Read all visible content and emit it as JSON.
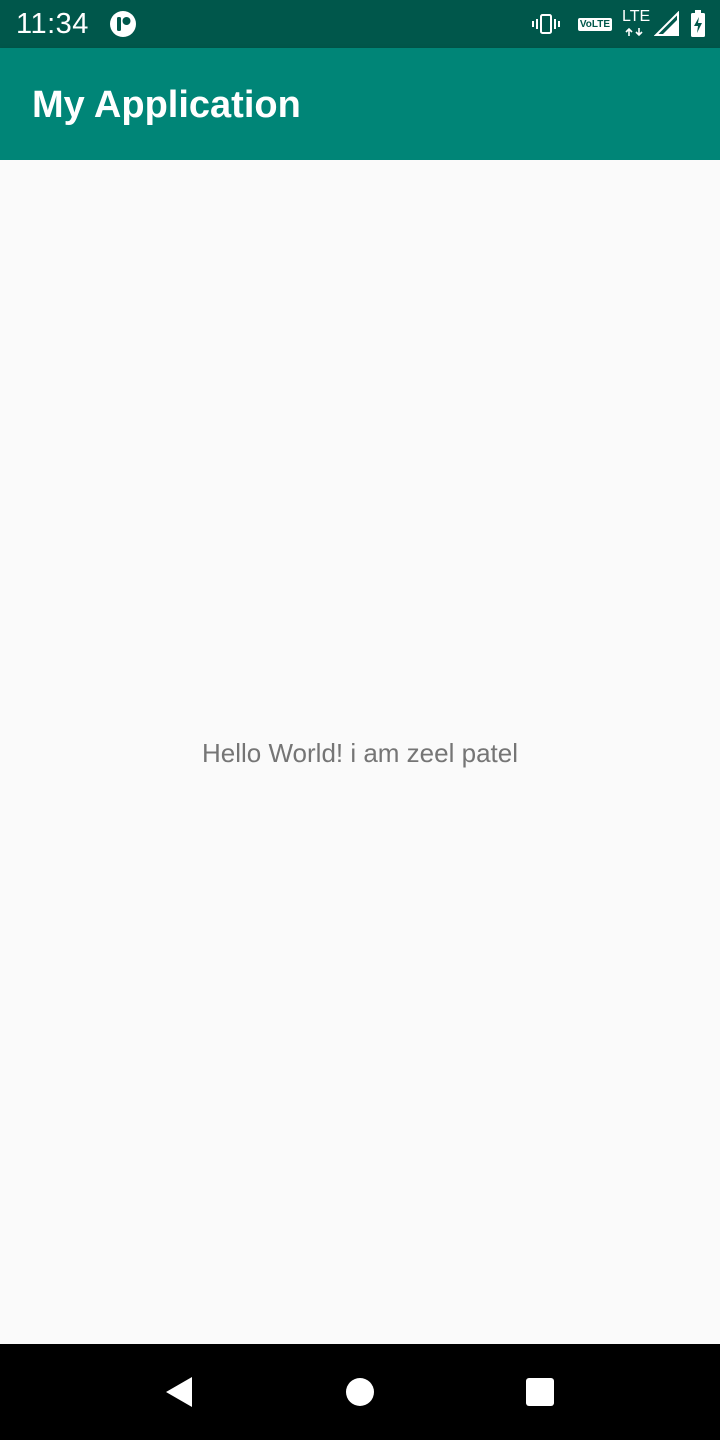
{
  "status_bar": {
    "time": "11:34",
    "volte_label": "VoLTE",
    "network_label": "LTE",
    "background_color": "#00574b",
    "icons": [
      "app-notification-icon",
      "vibrate-icon",
      "volte-icon",
      "lte-data-icon",
      "signal-icon",
      "battery-charging-icon"
    ]
  },
  "app_bar": {
    "title": "My Application",
    "background_color": "#008577"
  },
  "main": {
    "message": "Hello World! i am zeel patel"
  },
  "nav_bar": {
    "icons": [
      "back-icon",
      "home-icon",
      "recents-icon"
    ]
  }
}
